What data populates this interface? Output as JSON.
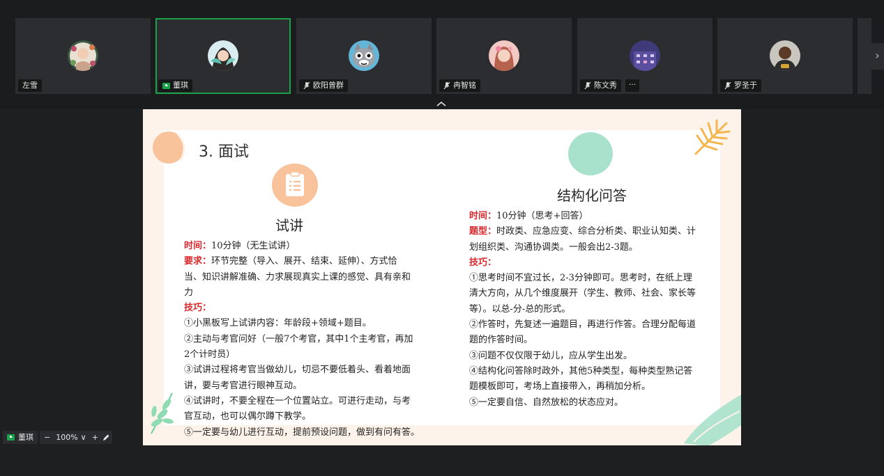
{
  "participants": [
    {
      "name": "左雪",
      "status": "none",
      "avatar": "avatar-floral-girl"
    },
    {
      "name": "董琪",
      "status": "sharing",
      "avatar": "avatar-girl-teal"
    },
    {
      "name": "欧阳曾群",
      "status": "muted",
      "avatar": "avatar-cat-cartoon"
    },
    {
      "name": "冉智铭",
      "status": "muted",
      "avatar": "avatar-girl-pink"
    },
    {
      "name": "陈文秀",
      "status": "muted",
      "avatar": "avatar-purple-building",
      "more": "···"
    },
    {
      "name": "罗圣于",
      "status": "muted",
      "avatar": "avatar-man-dark"
    }
  ],
  "presenter": {
    "name": "董琪"
  },
  "zoom": {
    "minus": "−",
    "value": "100%",
    "caret": "∨",
    "plus": "+"
  },
  "slide": {
    "section_title": "3. 面试",
    "left": {
      "title": "试讲",
      "icon": "clipboard-list-icon",
      "time_label": "时间：",
      "time_value": "10分钟（无生试讲）",
      "req_label": "要求：",
      "req_line1": "环节完整（导入、展开、结束、延伸）、方式恰",
      "req_line2": "当、知识讲解准确、力求展现真实上课的感觉、具有亲和",
      "req_line3": "力",
      "tips_label": "技巧：",
      "tips": [
        "①小黑板写上试讲内容：年龄段+领域+题目。",
        "②主动与考官问好（一般7个考官，其中1个主考官，再加",
        "2个计时员）",
        "③试讲过程将考官当做幼儿，切忌不要低着头、看着地面",
        "讲，要与考官进行眼神互动。",
        "④试讲时，不要全程在一个位置站立。可进行走动，与考",
        "官互动，也可以偶尔蹲下教学。",
        "⑤一定要与幼儿进行互动，提前预设问题，做到有问有答。"
      ]
    },
    "right": {
      "title": "结构化问答",
      "time_label": "时间：",
      "time_value": "10分钟（思考+回答）",
      "type_label": "题型：",
      "type_line1": "时政类、应急应变、综合分析类、职业认知类、计",
      "type_line2": "划组织类、沟通协调类。一般会出2-3题。",
      "tips_label": "技巧：",
      "tips": [
        "①思考时间不宜过长，2-3分钟即可。思考时，在纸上理",
        "清大方向，从几个维度展开（学生、教师、社会、家长等",
        "等）。以总-分-总的形式。",
        "②作答时，先复述一遍题目，再进行作答。合理分配每道",
        "题的作答时间。",
        "③问题不仅仅限于幼儿，应从学生出发。",
        "④结构化问答除时政外，其他5种类型，每种类型熟记答",
        "题模板即可，考场上直接带入，再稍加分析。",
        "⑤一定要自信、自然放松的状态应对。"
      ]
    }
  },
  "colors": {
    "accent_green": "#1aa14a",
    "label_red": "#d8262b",
    "peach": "#f8c39b",
    "mint": "#a8e2cc",
    "leaf_orange": "#f6b64f"
  }
}
